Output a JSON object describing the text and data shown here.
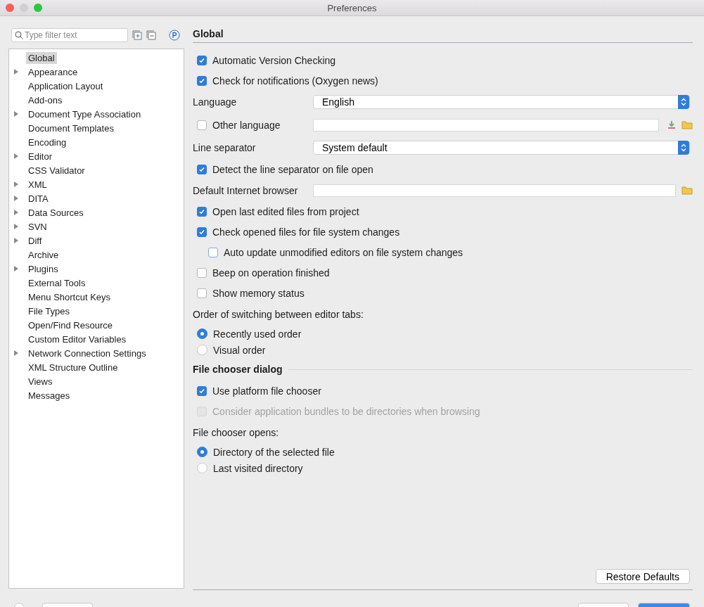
{
  "window": {
    "title": "Preferences"
  },
  "filter": {
    "placeholder": "Type filter text"
  },
  "tree": [
    {
      "label": "Global",
      "selected": true,
      "expandable": false
    },
    {
      "label": "Appearance",
      "selected": false,
      "expandable": true
    },
    {
      "label": "Application Layout",
      "selected": false,
      "expandable": false
    },
    {
      "label": "Add-ons",
      "selected": false,
      "expandable": false
    },
    {
      "label": "Document Type Association",
      "selected": false,
      "expandable": true
    },
    {
      "label": "Document Templates",
      "selected": false,
      "expandable": false
    },
    {
      "label": "Encoding",
      "selected": false,
      "expandable": false
    },
    {
      "label": "Editor",
      "selected": false,
      "expandable": true
    },
    {
      "label": "CSS Validator",
      "selected": false,
      "expandable": false
    },
    {
      "label": "XML",
      "selected": false,
      "expandable": true
    },
    {
      "label": "DITA",
      "selected": false,
      "expandable": true
    },
    {
      "label": "Data Sources",
      "selected": false,
      "expandable": true
    },
    {
      "label": "SVN",
      "selected": false,
      "expandable": true
    },
    {
      "label": "Diff",
      "selected": false,
      "expandable": true
    },
    {
      "label": "Archive",
      "selected": false,
      "expandable": false
    },
    {
      "label": "Plugins",
      "selected": false,
      "expandable": true
    },
    {
      "label": "External Tools",
      "selected": false,
      "expandable": false
    },
    {
      "label": "Menu Shortcut Keys",
      "selected": false,
      "expandable": false
    },
    {
      "label": "File Types",
      "selected": false,
      "expandable": false
    },
    {
      "label": "Open/Find Resource",
      "selected": false,
      "expandable": false
    },
    {
      "label": "Custom Editor Variables",
      "selected": false,
      "expandable": false
    },
    {
      "label": "Network Connection Settings",
      "selected": false,
      "expandable": true
    },
    {
      "label": "XML Structure Outline",
      "selected": false,
      "expandable": false
    },
    {
      "label": "Views",
      "selected": false,
      "expandable": false
    },
    {
      "label": "Messages",
      "selected": false,
      "expandable": false
    }
  ],
  "panel": {
    "title": "Global",
    "settings": [
      {
        "kind": "checkbox",
        "label": "Automatic Version Checking",
        "checked": true,
        "disabled": false
      },
      {
        "kind": "checkbox",
        "label": "Check for notifications (Oxygen news)",
        "checked": true,
        "disabled": false
      },
      {
        "kind": "select",
        "label": "Language",
        "value": "English"
      },
      {
        "kind": "checkbox-field",
        "label": "Other language",
        "checked": false,
        "disabled": false
      },
      {
        "kind": "select",
        "label": "Line separator",
        "value": "System default"
      },
      {
        "kind": "checkbox",
        "label": "Detect the line separator on file open",
        "checked": true,
        "disabled": false
      },
      {
        "kind": "field",
        "label": "Default Internet browser"
      },
      {
        "kind": "checkbox",
        "label": "Open last edited files from project",
        "checked": true,
        "disabled": false
      },
      {
        "kind": "checkbox",
        "label": "Check opened files for file system changes",
        "checked": true,
        "disabled": false,
        "children": [
          {
            "kind": "checkbox",
            "label": "Auto update unmodified editors on file system changes",
            "checked": false,
            "disabled": false
          }
        ]
      },
      {
        "kind": "checkbox",
        "label": "Beep on operation finished",
        "checked": false,
        "disabled": false
      },
      {
        "kind": "checkbox",
        "label": "Show memory status",
        "checked": false,
        "disabled": false
      },
      {
        "kind": "radio-group",
        "label": "Order of switching between editor tabs:",
        "options": [
          {
            "label": "Recently used order",
            "selected": true
          },
          {
            "label": "Visual order",
            "selected": false
          }
        ]
      },
      {
        "kind": "section",
        "label": "File chooser dialog"
      },
      {
        "kind": "checkbox",
        "label": "Use platform file chooser",
        "checked": true,
        "disabled": false
      },
      {
        "kind": "checkbox",
        "label": "Consider application bundles to be directories when browsing",
        "checked": false,
        "disabled": true
      },
      {
        "kind": "radio-group",
        "label": "File chooser opens:",
        "options": [
          {
            "label": "Directory of the selected file",
            "selected": true
          },
          {
            "label": "Last visited directory",
            "selected": false
          }
        ]
      }
    ],
    "restore_button": "Restore Defaults"
  }
}
